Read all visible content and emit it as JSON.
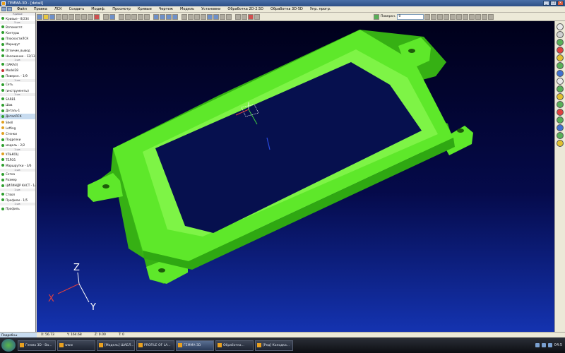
{
  "window": {
    "title": "ГЕММА-3D - [detail]",
    "minimize": "_",
    "maximize": "□",
    "close": "×"
  },
  "menu": [
    "Файл",
    "Правка",
    "ЛСК",
    "Создать",
    "Модиф.",
    "Просмотр",
    "Кривые",
    "Чертеж",
    "Модель",
    "Установки",
    "Обработка 2D-2.5D",
    "Обработка 3D-5D",
    "Упр. прогр."
  ],
  "toolbar": {
    "combo_label": "Поверхн.",
    "combo_value": "0"
  },
  "left_panel": {
    "rows": [
      {
        "type": "sep",
        "text": "Кривые"
      },
      {
        "type": "item",
        "text": "Кривые - 8/234",
        "dot": "ok"
      },
      {
        "type": "sep",
        "text": "5 шт."
      },
      {
        "type": "item",
        "text": "Вспомогат.",
        "dot": "ok"
      },
      {
        "type": "item",
        "text": "Контуры",
        "dot": "ok"
      },
      {
        "type": "item",
        "text": "ПлоскостиЛСК",
        "dot": "ok"
      },
      {
        "type": "item",
        "text": "Маршрут",
        "dot": "ok"
      },
      {
        "type": "item",
        "text": "Отличие_вывод",
        "dot": "ok"
      },
      {
        "type": "item",
        "text": "Наложение - 12/130",
        "dot": "ok"
      },
      {
        "type": "sep",
        "text": "1 шт."
      },
      {
        "type": "item",
        "text": "(ЗАКАЗ)",
        "dot": "ok"
      },
      {
        "type": "item",
        "text": "Model28",
        "dot": "red"
      },
      {
        "type": "item",
        "text": "Поверхн. - 1/9",
        "dot": "ok"
      },
      {
        "type": "sep",
        "text": "1 шт."
      },
      {
        "type": "item",
        "text": "Сеть",
        "dot": "ok"
      },
      {
        "type": "item",
        "text": "(инструменты)",
        "dot": "ok"
      },
      {
        "type": "sep",
        "text": "1 шт."
      },
      {
        "type": "item",
        "text": "SARB1",
        "dot": "ok"
      },
      {
        "type": "item",
        "text": "Шов",
        "dot": "ok"
      },
      {
        "type": "item",
        "text": "Деталь-1",
        "dot": "ok"
      },
      {
        "type": "item",
        "text": "ДеталЛСК",
        "dot": "ok",
        "active": true
      },
      {
        "type": "item",
        "text": "Shell",
        "dot": "warn"
      },
      {
        "type": "item",
        "text": "Lofting",
        "dot": "warn"
      },
      {
        "type": "item",
        "text": "Стенки",
        "dot": "warn"
      },
      {
        "type": "item",
        "text": "Подрезки",
        "dot": "ok"
      },
      {
        "type": "item",
        "text": "модель - 2/2",
        "dot": "ok"
      },
      {
        "type": "sep",
        "text": "1 шт."
      },
      {
        "type": "item",
        "text": "УЛЬКОЦ",
        "dot": "warn"
      },
      {
        "type": "item",
        "text": "ТЕЛО1",
        "dot": "ok"
      },
      {
        "type": "item",
        "text": "Маршрутки - 3/6",
        "dot": "ok"
      },
      {
        "type": "sep",
        "text": "1 шт."
      },
      {
        "type": "item",
        "text": "Сетка",
        "dot": "ok"
      },
      {
        "type": "item",
        "text": "Размер",
        "dot": "ok"
      },
      {
        "type": "item",
        "text": "ЦИЛИНДР КАСТ - 1/3",
        "dot": "ok"
      },
      {
        "type": "sep",
        "text": "1 шт."
      },
      {
        "type": "item",
        "text": "Ствол",
        "dot": "ok"
      },
      {
        "type": "item",
        "text": "Профили - 1/5",
        "dot": "ok"
      },
      {
        "type": "sep",
        "text": "1 шт."
      },
      {
        "type": "item",
        "text": "Профиль",
        "dot": "ok"
      }
    ],
    "bottom_label": "Подробн.▸"
  },
  "coords": {
    "x": "X: 56.73",
    "y": "Y: 164.68",
    "z": "Z: 0.00",
    "t": "T: 0"
  },
  "axis_labels": {
    "x": "X",
    "y": "Y",
    "z": "Z"
  },
  "taskbar": {
    "tasks": [
      {
        "label": "Геммa 3D - Ва...",
        "active": false
      },
      {
        "label": "www",
        "active": false
      },
      {
        "label": "[Модель] ШАБЛ...",
        "active": false
      },
      {
        "label": "PROFILE OF LA...",
        "active": false
      },
      {
        "label": "ГЕММА-3D",
        "active": true
      },
      {
        "label": "Обработка...",
        "active": false
      },
      {
        "label": "[Ред] Колодка...",
        "active": false
      }
    ],
    "clock": "04:5"
  },
  "colors": {
    "model": "#5ee82a",
    "model_dark": "#2fa812",
    "model_light": "#8ff84e"
  }
}
